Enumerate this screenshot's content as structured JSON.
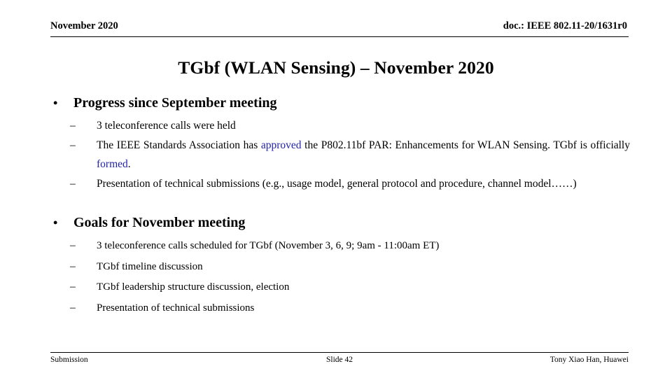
{
  "header": {
    "left": "November 2020",
    "right": "doc.: IEEE 802.11-20/1631r0"
  },
  "title": "TGbf (WLAN Sensing) – November 2020",
  "accent_color": "#2222AA",
  "markers": {
    "level1": "•",
    "level2": "–"
  },
  "content": {
    "group1": {
      "heading": "Progress since September meeting",
      "items": [
        {
          "text": "3 teleconference calls were held"
        },
        {
          "prefix": "The IEEE Standards Association has ",
          "highlight1": "approved",
          "middle": " the P802.11bf PAR: Enhancements for WLAN Sensing. TGbf is officially ",
          "highlight2": "formed",
          "suffix": "."
        },
        {
          "text": "Presentation of technical submissions (e.g., usage model, general protocol and procedure, channel model……)"
        }
      ]
    },
    "group2": {
      "heading": "Goals for November meeting",
      "items": [
        {
          "text": "3 teleconference calls scheduled for TGbf (November 3, 6, 9; 9am - 11:00am ET)"
        },
        {
          "text": "TGbf timeline discussion"
        },
        {
          "text": "TGbf leadership structure discussion, election"
        },
        {
          "text": "Presentation of technical submissions"
        }
      ]
    }
  },
  "footer": {
    "left": "Submission",
    "center": "Slide 42",
    "right": "Tony Xiao Han, Huawei"
  }
}
